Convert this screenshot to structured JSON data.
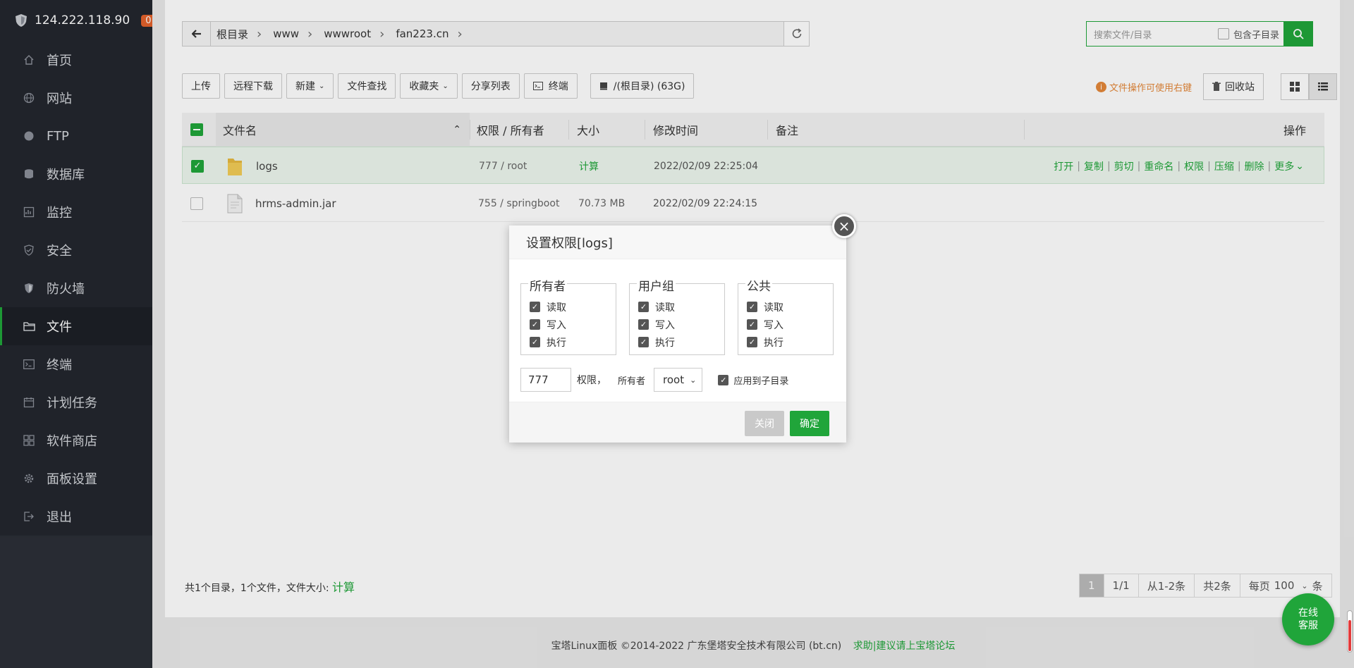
{
  "header": {
    "ip": "124.222.118.90",
    "badge": "0"
  },
  "sidebar": {
    "items": [
      {
        "label": "首页",
        "icon": "home-icon"
      },
      {
        "label": "网站",
        "icon": "globe-icon"
      },
      {
        "label": "FTP",
        "icon": "ftp-icon"
      },
      {
        "label": "数据库",
        "icon": "database-icon"
      },
      {
        "label": "监控",
        "icon": "monitor-icon"
      },
      {
        "label": "安全",
        "icon": "shield-icon"
      },
      {
        "label": "防火墙",
        "icon": "firewall-icon"
      },
      {
        "label": "文件",
        "icon": "folder-icon"
      },
      {
        "label": "终端",
        "icon": "terminal-icon"
      },
      {
        "label": "计划任务",
        "icon": "calendar-icon"
      },
      {
        "label": "软件商店",
        "icon": "apps-icon"
      },
      {
        "label": "面板设置",
        "icon": "gear-icon"
      },
      {
        "label": "退出",
        "icon": "logout-icon"
      }
    ],
    "active_index": 7
  },
  "path": {
    "crumbs": [
      "根目录",
      "www",
      "wwwroot",
      "fan223.cn"
    ]
  },
  "search": {
    "placeholder": "搜索文件/目录",
    "subdir_label": "包含子目录"
  },
  "toolbar": {
    "upload": "上传",
    "remote_download": "远程下载",
    "new": "新建",
    "find": "文件查找",
    "favorites": "收藏夹",
    "share_list": "分享列表",
    "terminal": "终端",
    "disk": "/(根目录) (63G)",
    "tip": "文件操作可使用右键",
    "recycle": "回收站"
  },
  "table": {
    "headers": {
      "name": "文件名",
      "perm": "权限 / 所有者",
      "size": "大小",
      "mtime": "修改时间",
      "note": "备注",
      "ops": "操作"
    },
    "rows": [
      {
        "name": "logs",
        "perm": "777 / root",
        "size": "计算",
        "mtime": "2022/02/09 22:25:04",
        "checked": true,
        "type": "folder"
      },
      {
        "name": "hrms-admin.jar",
        "perm": "755 / springboot",
        "size": "70.73 MB",
        "mtime": "2022/02/09 22:24:15",
        "checked": false,
        "type": "file"
      }
    ],
    "ops": [
      "打开",
      "复制",
      "剪切",
      "重命名",
      "权限",
      "压缩",
      "删除",
      "更多"
    ]
  },
  "summary": {
    "text": "共1个目录，1个文件，文件大小:",
    "calc": "计算"
  },
  "pager": {
    "current": "1",
    "pages": "1/1",
    "range": "从1-2条",
    "total": "共2条",
    "per_page_label": "每页",
    "per_page": "100",
    "unit": "条"
  },
  "dialog": {
    "title": "设置权限[logs]",
    "groups": [
      {
        "name": "所有者",
        "perms": [
          "读取",
          "写入",
          "执行"
        ]
      },
      {
        "name": "用户组",
        "perms": [
          "读取",
          "写入",
          "执行"
        ]
      },
      {
        "name": "公共",
        "perms": [
          "读取",
          "写入",
          "执行"
        ]
      }
    ],
    "mode": "777",
    "perm_label": "权限，",
    "owner_label": "所有者",
    "owner": "root",
    "apply_sub": "应用到子目录",
    "close": "关闭",
    "ok": "确定"
  },
  "footer": {
    "copyright": "宝塔Linux面板 ©2014-2022 广东堡塔安全技术有限公司 (bt.cn)",
    "help": "求助|建议请上宝塔论坛"
  },
  "service": {
    "line1": "在线",
    "line2": "客服"
  },
  "colors": {
    "accent": "#20a53a",
    "sidebar": "#23262e",
    "warning": "#e4883a"
  }
}
